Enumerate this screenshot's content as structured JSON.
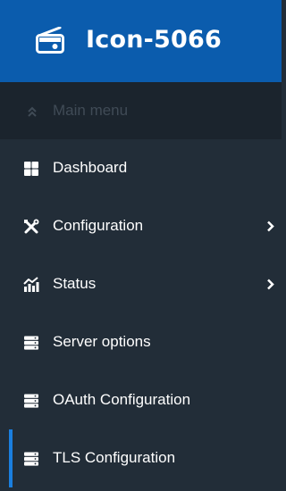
{
  "app": {
    "title": "Icon-5066",
    "icon": "radio-icon"
  },
  "menu_header": {
    "label": "Main menu",
    "icon": "chevrons-up-icon"
  },
  "nav": {
    "items": [
      {
        "label": "Dashboard",
        "icon": "dashboard-grid-icon",
        "has_submenu": false,
        "active": false
      },
      {
        "label": "Configuration",
        "icon": "tools-icon",
        "has_submenu": true,
        "active": false
      },
      {
        "label": "Status",
        "icon": "chart-icon",
        "has_submenu": true,
        "active": false
      },
      {
        "label": "Server options",
        "icon": "server-icon",
        "has_submenu": false,
        "active": false
      },
      {
        "label": "OAuth Configuration",
        "icon": "server-icon",
        "has_submenu": false,
        "active": false
      },
      {
        "label": "TLS Configuration",
        "icon": "server-icon",
        "has_submenu": false,
        "active": true
      }
    ]
  },
  "colors": {
    "header_bg": "#0b5cad",
    "menu_header_bg": "#1b242d",
    "sidebar_bg": "#222d38",
    "active_indicator": "#1a7fe0",
    "text": "#ffffff",
    "muted_text": "#404b56"
  }
}
